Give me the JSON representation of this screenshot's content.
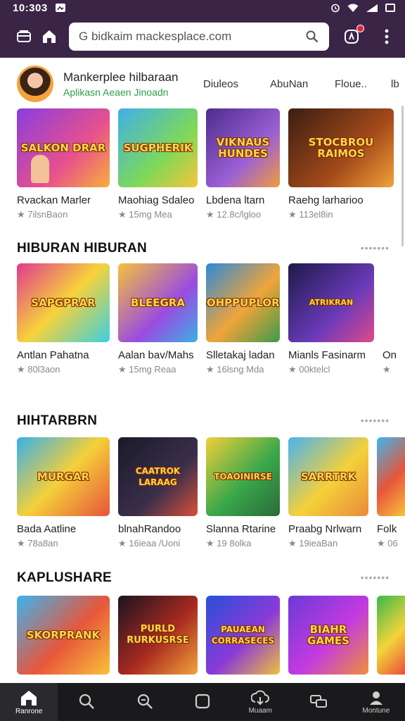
{
  "status_bar": {
    "time": "10:303"
  },
  "browser": {
    "url": "G  bidkaim mackesplace.com",
    "notification_badge_color": "#e0253b"
  },
  "profile": {
    "name": "Mankerplee hilbaraan",
    "subtitle": "Aplikasn Aeaen Jinoadn",
    "tabs": [
      "Diuleos",
      "AbuNan",
      "Floue..",
      "lb"
    ]
  },
  "sections": [
    {
      "title": "",
      "cards": [
        {
          "logo": "SALKON DRAR",
          "title": "Rvackan Marler",
          "meta": "★ 7ilsnBaon"
        },
        {
          "logo": "SUGPHERIK",
          "title": "Maohiag Sdaleo",
          "meta": "★ 15mg Mea"
        },
        {
          "logo": "VIKNAUS HUNDES",
          "title": "Lbdena ltarn",
          "meta": "★ 12.8c/lgloo"
        },
        {
          "logo": "STOCBROU RAIMOS",
          "title": "Raehg larharioo",
          "meta": "★ 113el8in"
        }
      ]
    },
    {
      "title": "HIBURAN HIBURAN",
      "cards": [
        {
          "logo": "SAPGPRAR",
          "title": "Antlan Pahatna",
          "meta": "★ 80l3aon"
        },
        {
          "logo": "BLEEGRA",
          "title": "Aalan bav/Mahs",
          "meta": "★ 15mg Reaa"
        },
        {
          "logo": "SOHPPUPLORE",
          "title": "Slletakaj ladan",
          "meta": "★ 16lsng Mda"
        },
        {
          "logo": "ATRIKRAN",
          "title": "Mianls Fasinarm",
          "meta": "★ 00ktelcl"
        },
        {
          "logo": "",
          "title": "On",
          "meta": "★"
        }
      ]
    },
    {
      "title": "HIHTARBRN",
      "cards": [
        {
          "logo": "MURGAR",
          "title": "Bada Aatline",
          "meta": "★ 78a8an"
        },
        {
          "logo": "CAATROK LARAAG",
          "title": "blnahRandoo",
          "meta": "★ 16ieaa /Uoni"
        },
        {
          "logo": "TOAOINIRSE",
          "title": "Slanna Rtarine",
          "meta": "★ 19 8olka"
        },
        {
          "logo": "SARRTRK",
          "title": "Praabg Nrlwarn",
          "meta": "★ 19ieaBan"
        },
        {
          "logo": "",
          "title": "Folk",
          "meta": "★ 06"
        }
      ]
    },
    {
      "title": "KAPLUSHARE",
      "cards": [
        {
          "logo": "SKORPRANK",
          "title": "",
          "meta": ""
        },
        {
          "logo": "PURLD RURKUSRSE",
          "title": "",
          "meta": ""
        },
        {
          "logo": "PAUAEAN CORRASECES",
          "title": "",
          "meta": ""
        },
        {
          "logo": "BIAHR GAMES",
          "title": "",
          "meta": ""
        },
        {
          "logo": "",
          "title": "",
          "meta": ""
        }
      ]
    }
  ],
  "section_more": "•••••••",
  "bottom_nav": [
    {
      "label": "Ranrone",
      "icon": "home-icon",
      "active": true
    },
    {
      "label": "",
      "icon": "search-icon"
    },
    {
      "label": "",
      "icon": "zoom-search-icon"
    },
    {
      "label": "",
      "icon": "square-icon"
    },
    {
      "label": "Muaam",
      "icon": "cloud-sync-icon"
    },
    {
      "label": "",
      "icon": "windows-icon"
    },
    {
      "label": "Montune",
      "icon": "profile-icon"
    }
  ]
}
